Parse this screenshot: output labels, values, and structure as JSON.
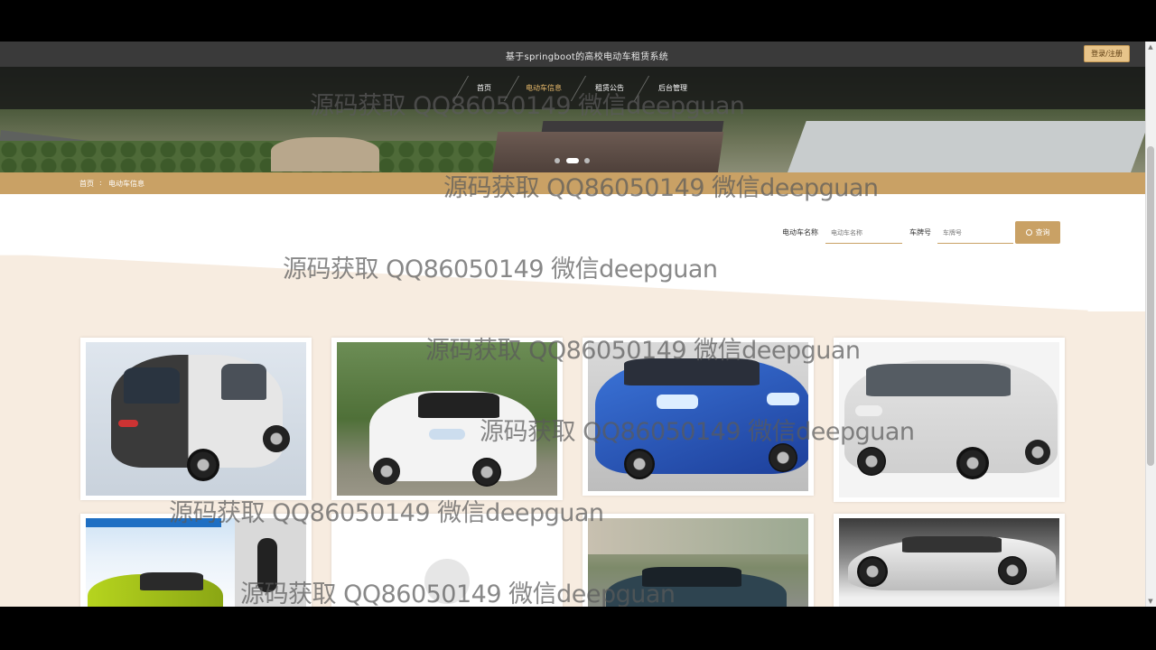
{
  "header": {
    "site_title": "基于springboot的高校电动车租赁系统",
    "login_label": "登录/注册"
  },
  "nav": {
    "items": [
      {
        "label": "首页"
      },
      {
        "label": "电动车信息"
      },
      {
        "label": "租赁公告"
      },
      {
        "label": "后台管理"
      }
    ],
    "active_index": 1
  },
  "carousel": {
    "slide_count": 3,
    "active_index": 1
  },
  "breadcrumb": {
    "home": "首页",
    "current": "电动车信息"
  },
  "filter": {
    "name_label": "电动车名称",
    "name_placeholder": "电动车名称",
    "plate_label": "车牌号",
    "plate_placeholder": "车牌号",
    "search_label": "查询"
  },
  "watermark": {
    "text": "源码获取 QQ86050149 微信deepguan"
  },
  "colors": {
    "accent": "#c9a165",
    "nav_bg": "#1e1e1e",
    "band": "#f7ece0"
  }
}
